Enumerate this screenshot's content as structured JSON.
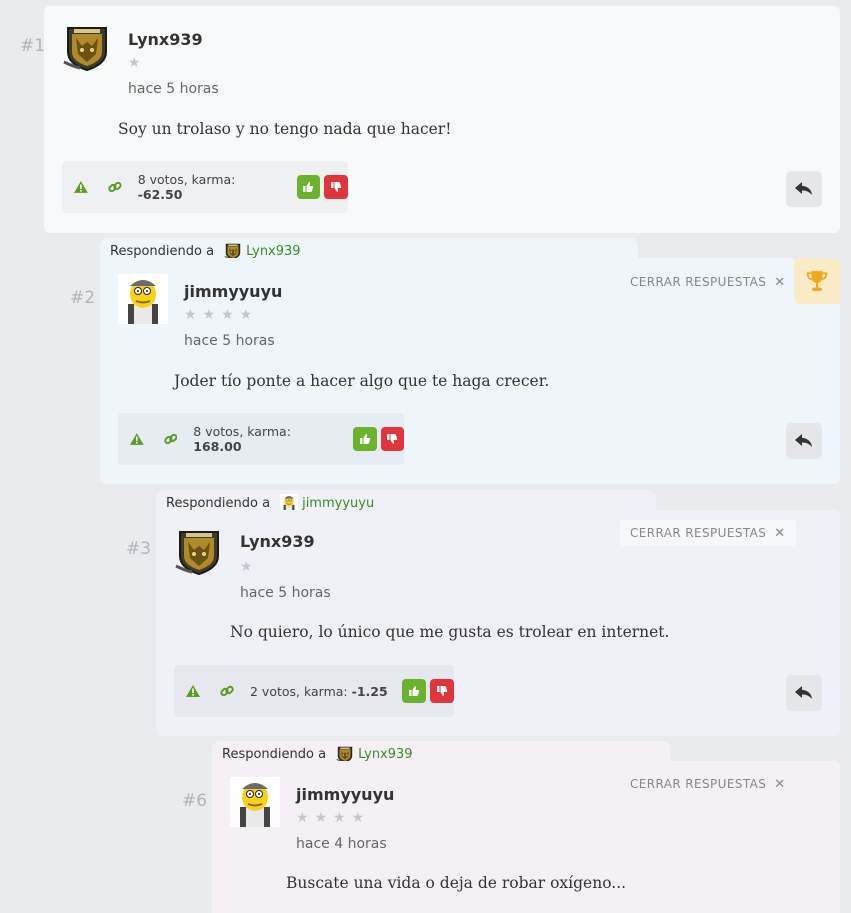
{
  "common": {
    "reply_prefix": "Respondiendo a",
    "close_label": "CERRAR RESPUESTAS",
    "close_x": "✕"
  },
  "comments": [
    {
      "number": "#1",
      "user": "Lynx939",
      "avatar": "fox-hound-avatar",
      "stars": "★",
      "time": "hace 5 horas",
      "text": "Soy un trolaso y no tengo nada que hacer!",
      "votes_text": "8 votos, karma:",
      "karma": "-62.50"
    },
    {
      "number": "#2",
      "replying_to": "Lynx939",
      "user": "jimmyyuyu",
      "avatar": "moe-avatar",
      "stars": "★★★★",
      "time": "hace 5 horas",
      "text": "Joder tío ponte a hacer algo que te haga crecer.",
      "votes_text": "8 votos, karma:",
      "karma": "168.00"
    },
    {
      "number": "#3",
      "replying_to": "jimmyyuyu",
      "user": "Lynx939",
      "avatar": "fox-hound-avatar",
      "stars": "★",
      "time": "hace 5 horas",
      "text": "No quiero, lo único que me gusta es trolear en internet.",
      "votes_text": "2 votos, karma:",
      "karma": "-1.25"
    },
    {
      "number": "#6",
      "replying_to": "Lynx939",
      "user": "jimmyyuyu",
      "avatar": "moe-avatar",
      "stars": "★★★★",
      "time": "hace 4 horas",
      "text": "Buscate una vida o deja de robar oxígeno..."
    }
  ],
  "colors": {
    "upvote": "#6bb32c",
    "downvote": "#e0353a",
    "mention": "#3a8e1f",
    "trophy": "#f2a81d"
  }
}
